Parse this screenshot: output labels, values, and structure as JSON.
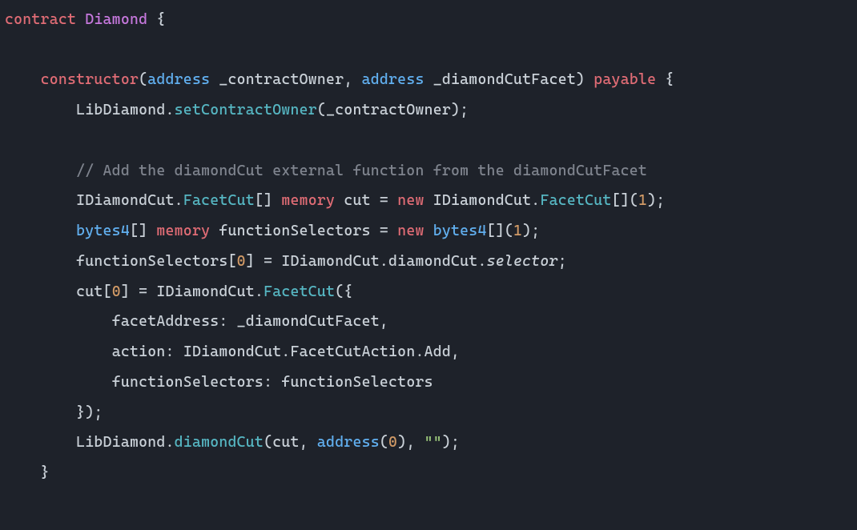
{
  "code": {
    "t_contract": "contract",
    "t_Diamond": "Diamond",
    "t_obrace": " {",
    "t_constructor": "constructor",
    "t_address": "address",
    "t_contractOwner": "_contractOwner",
    "t_diamondCutFacet": "_diamondCutFacet",
    "t_payable": "payable",
    "t_LibDiamond": "LibDiamond",
    "t_setContractOwner": "setContractOwner",
    "t_comment": "// Add the diamondCut external function from the diamondCutFacet",
    "t_IDiamondCut": "IDiamondCut",
    "t_FacetCut": "FacetCut",
    "t_memory": "memory",
    "t_cut": "cut",
    "t_new": "new",
    "t_bytes4": "bytes4",
    "t_functionSelectors": "functionSelectors",
    "t_diamondCut": "diamondCut",
    "t_selector": "selector",
    "t_facetAddress": "facetAddress",
    "t_action": "action",
    "t_FacetCutAction": "FacetCutAction",
    "t_Add": "Add",
    "t_funcSelKey": "functionSelectors",
    "t_empty": "\"\"",
    "n0": "0",
    "n1": "1"
  }
}
